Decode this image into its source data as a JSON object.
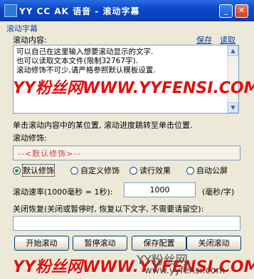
{
  "title": {
    "text": "YY CC AK 语音 - 滚动字幕"
  },
  "window_controls": {
    "minimize": "_",
    "close": "✕"
  },
  "section": {
    "title": "滚动字幕"
  },
  "content": {
    "label": "滚动内容:",
    "save": "保存",
    "read": "读取",
    "lines": [
      "可以自己在这里输入想要滚动显示的文字.",
      "也可以读取文本文件(限制32767字).",
      "滚动修饰不可少,请严格参照默认模板设置."
    ]
  },
  "hint": "单击滚动内容中的某位置, 滚动进度跳转至单击位置.",
  "decoration": {
    "label": "滚动修饰:",
    "value": "--<默认修饰>--"
  },
  "radios": [
    "默认修饰",
    "自定义修饰",
    "读行效果",
    "自动公屏"
  ],
  "selected_radio": "默认修饰",
  "speed": {
    "label": "滚动速率(1000毫秒 = 1秒):",
    "value": "1000",
    "unit": "(毫秒/字)"
  },
  "close_restore": {
    "label": "关闭恢复(关闭或暂停时, 恢复以下文字, 不需要请留空):",
    "value": ""
  },
  "buttons": {
    "start": "开始滚动",
    "pause": "暂停滚动",
    "save_config": "保存配置",
    "close": "关闭滚动"
  },
  "watermarks": {
    "red1": "YY粉丝网WWW.YYFENSI.COM",
    "red2": "YY粉丝网WWW.YYFENSI.COM",
    "gray": "YY粉丝网",
    "url": "www.yyfensi.com"
  },
  "colors": {
    "titlebar": "#0a46c8",
    "window": "#ece9d8",
    "accent": "#1c4ba8",
    "watermark": "#e01010"
  }
}
